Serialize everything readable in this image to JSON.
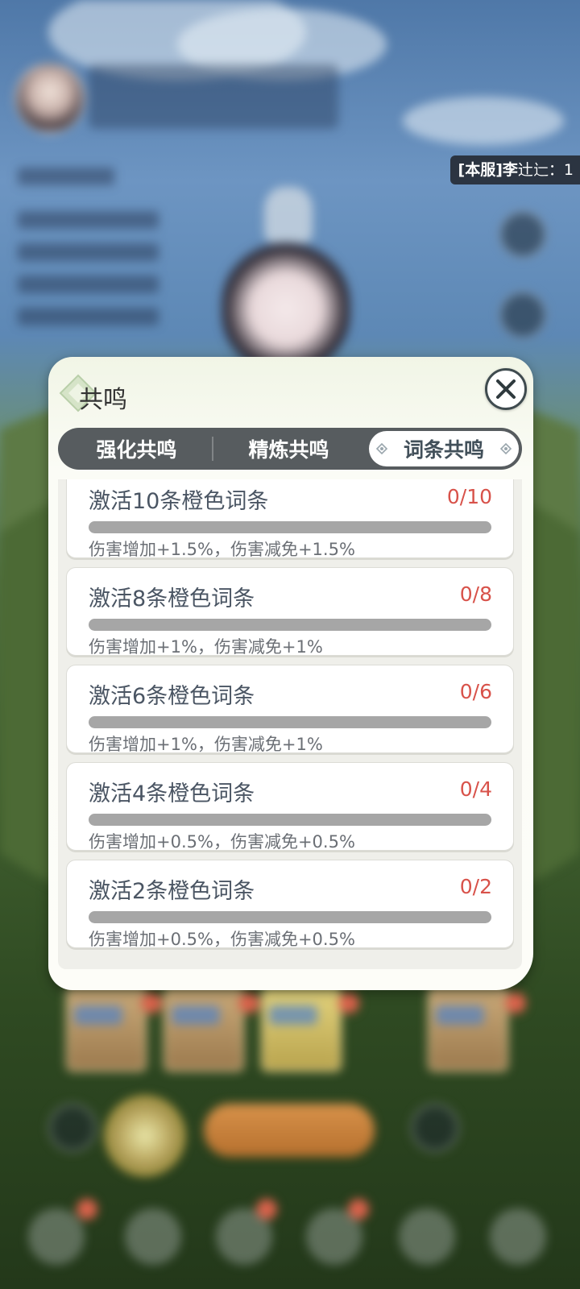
{
  "chat_ticker": {
    "prefix": "[本服]李",
    "text": "辻辷：1"
  },
  "dialog": {
    "title": "共鸣",
    "close_icon": "close-icon",
    "tabs": [
      {
        "label": "强化共鸣",
        "active": false
      },
      {
        "label": "精炼共鸣",
        "active": false
      },
      {
        "label": "词条共鸣",
        "active": true
      }
    ],
    "items": [
      {
        "title": "激活10条橙色词条",
        "count": "0/10",
        "progress": 0,
        "effect": "伤害增加+1.5%，伤害减免+1.5%"
      },
      {
        "title": "激活8条橙色词条",
        "count": "0/8",
        "progress": 0,
        "effect": "伤害增加+1%，伤害减免+1%"
      },
      {
        "title": "激活6条橙色词条",
        "count": "0/6",
        "progress": 0,
        "effect": "伤害增加+1%，伤害减免+1%"
      },
      {
        "title": "激活4条橙色词条",
        "count": "0/4",
        "progress": 0,
        "effect": "伤害增加+0.5%，伤害减免+0.5%"
      },
      {
        "title": "激活2条橙色词条",
        "count": "0/2",
        "progress": 0,
        "effect": "伤害增加+0.5%，伤害减免+0.5%"
      }
    ]
  },
  "colors": {
    "count_red": "#d8524a",
    "tab_bar": "#575c5f",
    "bar_track": "#a6a6a6"
  }
}
